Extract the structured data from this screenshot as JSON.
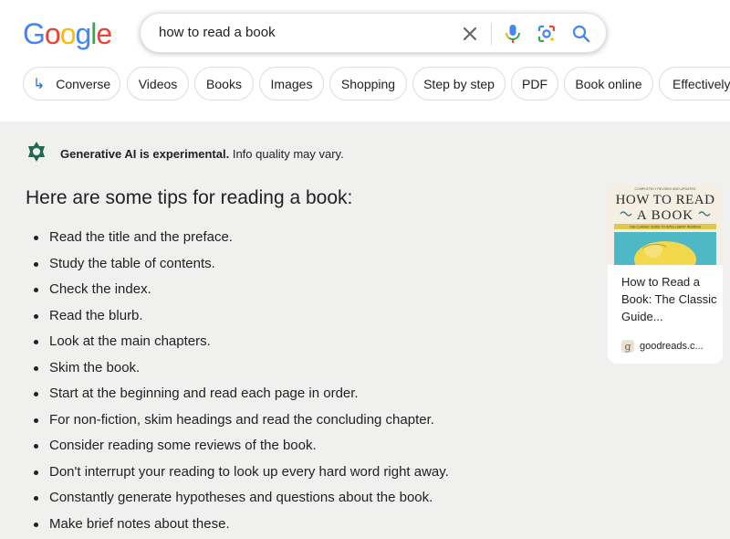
{
  "logo": {
    "letters": [
      "G",
      "o",
      "o",
      "g",
      "l",
      "e"
    ],
    "colors": [
      "#4285F4",
      "#EA4335",
      "#FBBC05",
      "#4285F4",
      "#34A853",
      "#EA4335"
    ]
  },
  "search": {
    "query": "how to read a book",
    "icons": [
      "clear-icon",
      "mic-icon",
      "lens-icon",
      "search-icon"
    ]
  },
  "chips": [
    {
      "label": "Converse",
      "icon": "converse-arrow-icon"
    },
    {
      "label": "Videos"
    },
    {
      "label": "Books"
    },
    {
      "label": "Images"
    },
    {
      "label": "Shopping"
    },
    {
      "label": "Step by step"
    },
    {
      "label": "PDF"
    },
    {
      "label": "Book online"
    },
    {
      "label": "Effectively"
    }
  ],
  "ai_panel": {
    "notice_bold": "Generative AI is experimental.",
    "notice_rest": " Info quality may vary.",
    "heading": "Here are some tips for reading a book:",
    "tips": [
      "Read the title and the preface.",
      "Study the table of contents.",
      "Check the index.",
      "Read the blurb.",
      "Look at the main chapters.",
      "Skim the book.",
      "Start at the beginning and read each page in order.",
      "For non-fiction, skim headings and read the concluding chapter.",
      "Consider reading some reviews of the book.",
      "Don't interrupt your reading to look up every hard word right away.",
      "Constantly generate hypotheses and questions about the book.",
      "Make brief notes about these."
    ]
  },
  "source_card": {
    "cover_top_line": "COMPLETELY REVISED AND UPDATED",
    "cover_title_1": "HOW TO READ",
    "cover_title_2": "A BOOK",
    "cover_subtitle": "THE CLASSIC GUIDE TO INTELLIGENT READING",
    "title": "How to Read a Book: The Classic Guide...",
    "favicon_letter": "g",
    "source": "goodreads.c..."
  },
  "colors": {
    "panel_bg": "#f0f1ee",
    "accent_blue": "#1a73e8",
    "ai_icon": "#1e6b52"
  }
}
